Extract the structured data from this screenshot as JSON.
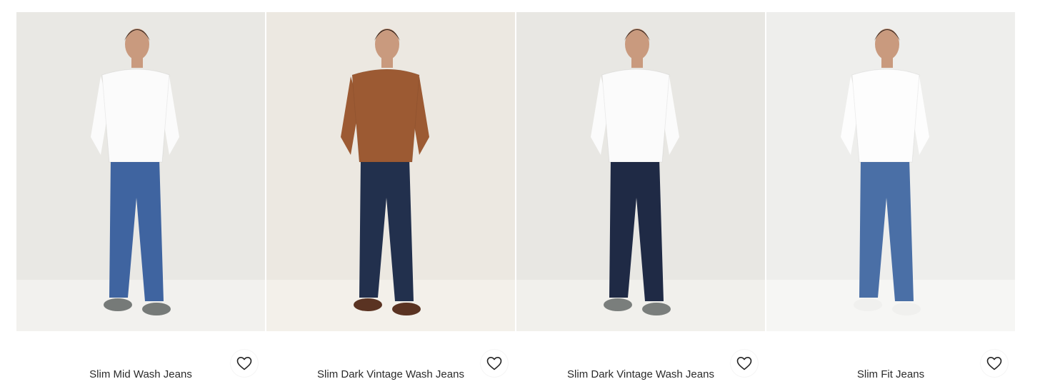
{
  "products": [
    {
      "name": "Slim Mid Wash Jeans",
      "bg": "#e9e8e4",
      "floor": "#f2f1ee",
      "top": "#fbfbfb",
      "jeans": "#3f64a0",
      "shoes": "#767a78",
      "skin": "#c99a7e",
      "hair": "#3a2a22",
      "icon": "heart-outline-icon"
    },
    {
      "name": "Slim Dark Vintage Wash Jeans",
      "bg": "#ece8e1",
      "floor": "#f3f0ea",
      "top": "#9c5a33",
      "jeans": "#22304d",
      "shoes": "#5a3322",
      "skin": "#c99a7e",
      "hair": "#2a1d16",
      "icon": "heart-outline-icon"
    },
    {
      "name": "Slim Dark Vintage Wash Jeans",
      "bg": "#e8e7e3",
      "floor": "#f1f0ec",
      "top": "#fbfbfb",
      "jeans": "#1f2a45",
      "shoes": "#7a7e7c",
      "skin": "#c99a7e",
      "hair": "#3a2a22",
      "icon": "heart-outline-icon"
    },
    {
      "name": "Slim Fit Jeans",
      "bg": "#eeeeec",
      "floor": "#f6f6f4",
      "top": "#fdfdfd",
      "jeans": "#4a6fa6",
      "shoes": "#f0f0ee",
      "skin": "#c99a7e",
      "hair": "#3a2a22",
      "icon": "heart-outline-icon"
    }
  ]
}
